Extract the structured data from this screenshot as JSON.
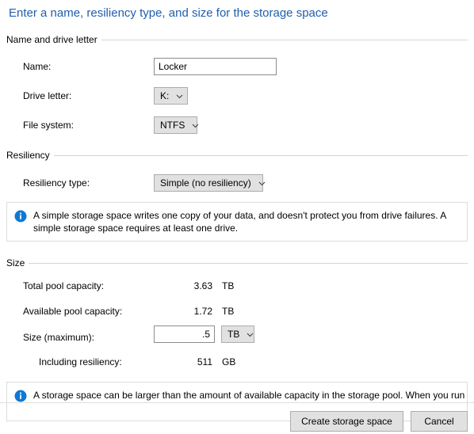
{
  "dialog": {
    "title": "Enter a name, resiliency type, and size for the storage space"
  },
  "groups": {
    "name_and_drive_letter": {
      "label": "Name and drive letter",
      "fields": {
        "name": {
          "label": "Name:",
          "value": "Locker"
        },
        "drive_letter": {
          "label": "Drive letter:",
          "value": "K:"
        },
        "file_system": {
          "label": "File system:",
          "value": "NTFS"
        }
      }
    },
    "resiliency": {
      "label": "Resiliency",
      "fields": {
        "resiliency_type": {
          "label": "Resiliency type:",
          "value": "Simple (no resiliency)"
        }
      },
      "info": {
        "icon": "info-icon",
        "text": "A simple storage space writes one copy of your data, and doesn't protect you from drive failures. A simple storage space requires at least one drive."
      }
    },
    "size": {
      "label": "Size",
      "rows": [
        {
          "label": "Total pool capacity:",
          "value": "3.63",
          "unit": "TB"
        },
        {
          "label": "Available pool capacity:",
          "value": "1.72",
          "unit": "TB"
        },
        {
          "label": "Including resiliency:",
          "value": "511",
          "unit": "GB"
        }
      ],
      "size_maximum": {
        "label": "Size (maximum):",
        "value": ".5",
        "unit": "TB"
      }
    }
  },
  "bottom_info": {
    "icon": "info-icon",
    "text": "A storage space can be larger than the amount of available capacity in the storage pool. When you run"
  },
  "footer": {
    "create_label": "Create storage space",
    "cancel_label": "Cancel"
  },
  "colors": {
    "title_blue": "#1f5fad",
    "info_blue": "#0f78d4",
    "control_face": "#e1e1e1",
    "control_border": "#acacac",
    "input_border": "#8c8c8c",
    "rule": "#d4d4d4"
  }
}
